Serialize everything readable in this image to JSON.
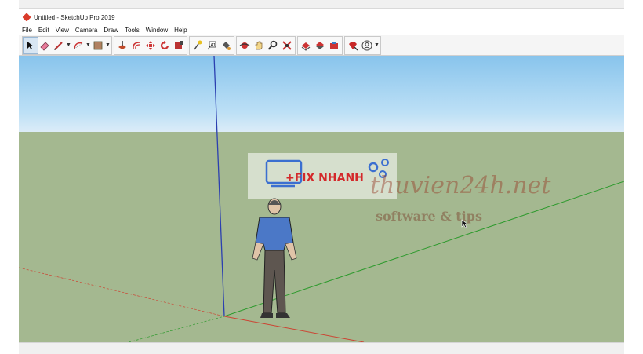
{
  "window": {
    "title": "Untitled - SketchUp Pro 2019"
  },
  "menu": [
    "File",
    "Edit",
    "View",
    "Camera",
    "Draw",
    "Tools",
    "Window",
    "Help"
  ],
  "toolbar": {
    "tools": [
      "select-icon",
      "eraser-icon",
      "pencil-line-icon",
      "arc-icon",
      "rectangle-icon",
      "push-pull-icon",
      "offset-icon",
      "move-icon",
      "rotate-icon",
      "scale-icon",
      "tape-measure-icon",
      "text-icon",
      "paint-bucket-icon",
      "orbit-icon",
      "pan-icon",
      "zoom-icon",
      "zoom-extents-icon",
      "warehouse-icon",
      "extension-icon",
      "component-icon",
      "ruby-icon",
      "account-icon"
    ]
  },
  "watermark": {
    "brand": "+FIX NHANH",
    "site": "thuvien24h.net",
    "tagline": "software & tips"
  },
  "colors": {
    "sky": "#9fd0f0",
    "ground": "#a4b890",
    "accent": "#d4282a"
  }
}
